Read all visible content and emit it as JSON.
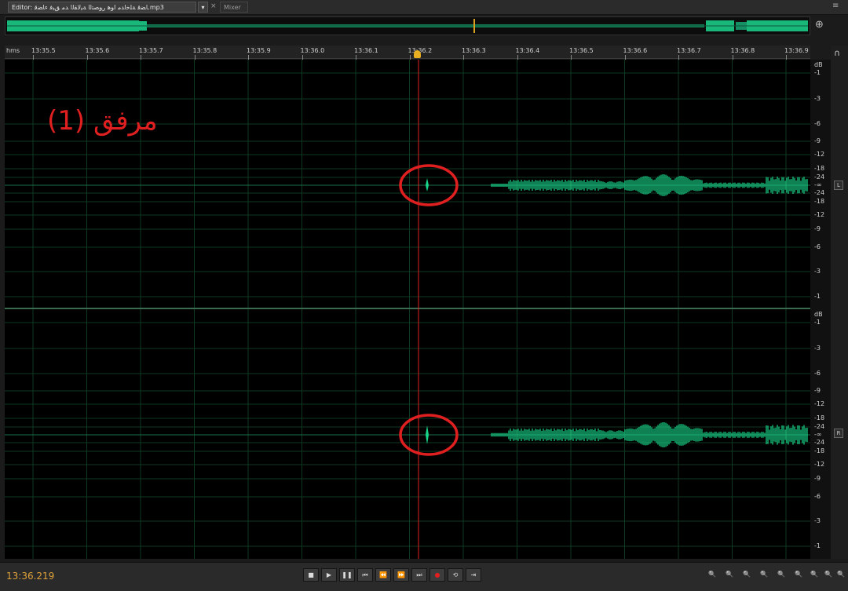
{
  "editor": {
    "tab_title": "Editor: ﺎﻀﻗ ﺔﻠﺧﺍﺪﻣ ﺍﻮﻫ ﺭﻮﺼﺘﻟﺍ ﺔﻴﻟﺎﻘﻟﺍ ﺪﻣ ﻖﻴﻓ ﺀﺎﻀﻗ.mp3",
    "dropdown_glyph": "▾",
    "close_glyph": "×",
    "mixer_tab": "Mixer",
    "panel_menu_glyph": "≡"
  },
  "ruler": {
    "unit": "hms",
    "ticks": [
      "13:35.5",
      "13:35.6",
      "13:35.7",
      "13:35.8",
      "13:35.9",
      "13:36.0",
      "13:36.1",
      "13:36.2",
      "13:36.3",
      "13:36.4",
      "13:36.5",
      "13:36.6",
      "13:36.7",
      "13:36.8",
      "13:36.9"
    ]
  },
  "db_scale": {
    "unit": "dB",
    "labels": [
      "-1",
      "-3",
      "-6",
      "-9",
      "-12",
      "-18",
      "-24",
      "-∞",
      "-24",
      "-18",
      "-12",
      "-9",
      "-6",
      "-3",
      "-1"
    ]
  },
  "channels": [
    {
      "name": "L"
    },
    {
      "name": "R"
    }
  ],
  "annotation": {
    "text": "مرفق (1)"
  },
  "playhead": {
    "time": "13:36.219"
  },
  "transport": {
    "buttons": [
      {
        "id": "stop",
        "glyph": "■"
      },
      {
        "id": "play",
        "glyph": "▶"
      },
      {
        "id": "pause",
        "glyph": "❚❚"
      },
      {
        "id": "goto-start",
        "glyph": "⏮"
      },
      {
        "id": "rewind",
        "glyph": "⏪"
      },
      {
        "id": "fast-forward",
        "glyph": "⏩"
      },
      {
        "id": "goto-end",
        "glyph": "⏭"
      },
      {
        "id": "record",
        "glyph": "●"
      },
      {
        "id": "loop",
        "glyph": "⟲"
      },
      {
        "id": "skip-selection",
        "glyph": "⇥"
      }
    ]
  },
  "zoom": {
    "buttons": [
      {
        "id": "zoom-in-amplitude",
        "glyph": "🔍"
      },
      {
        "id": "zoom-out-amplitude",
        "glyph": "🔍"
      },
      {
        "id": "zoom-in-time",
        "glyph": "🔍"
      },
      {
        "id": "zoom-out-time",
        "glyph": "🔍"
      },
      {
        "id": "zoom-out-full",
        "glyph": "🔍"
      },
      {
        "id": "zoom-in-point",
        "glyph": "🔍"
      },
      {
        "id": "zoom-selection",
        "glyph": "🔍"
      },
      {
        "id": "zoom-left-edge",
        "glyph": "🔍"
      },
      {
        "id": "zoom-right-edge",
        "glyph": "🔍"
      }
    ]
  },
  "colors": {
    "waveform": "#19d68a",
    "playhead": "#e02020",
    "annotation": "#e02020",
    "time_readout": "#e0a23a"
  }
}
